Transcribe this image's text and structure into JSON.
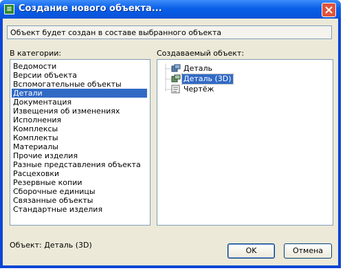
{
  "window": {
    "title": "Создание нового объекта..."
  },
  "info": "Объект будет создан в составе выбранного объекта",
  "categories": {
    "label": "В категории:",
    "items": [
      "Ведомости",
      "Версии объекта",
      "Вспомогательные объекты",
      "Детали",
      "Документация",
      "Извещения об изменениях",
      "Исполнения",
      "Комплексы",
      "Комплекты",
      "Материалы",
      "Прочие изделия",
      "Разные представления объекта",
      "Расцеховки",
      "Резервные копии",
      "Сборочные единицы",
      "Связанные объекты",
      "Стандартные изделия"
    ],
    "selected": "Детали"
  },
  "objects": {
    "label": "Создаваемый объект:",
    "items": [
      {
        "label": "Деталь",
        "icon": "part-icon"
      },
      {
        "label": "Деталь (3D)",
        "icon": "part-3d-icon"
      },
      {
        "label": "Чертёж",
        "icon": "drawing-icon"
      }
    ],
    "selected": "Деталь (3D)"
  },
  "status": "Объект: Деталь (3D)",
  "buttons": {
    "ok": "OK",
    "cancel": "Отмена"
  }
}
